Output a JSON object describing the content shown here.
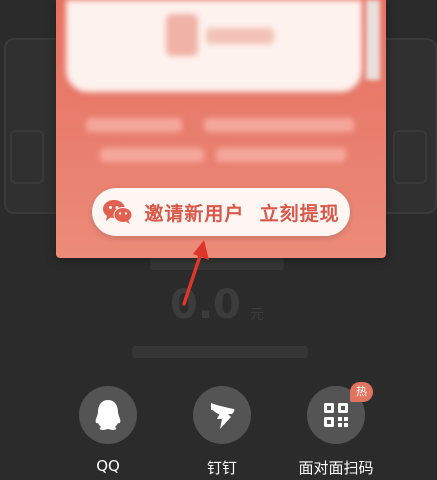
{
  "invite_card": {
    "button_label": "邀请新用户  立刻提现",
    "button_icon": "wechat-icon"
  },
  "balance": {
    "amount": "0.0",
    "unit": "元"
  },
  "share_options": [
    {
      "label": "QQ",
      "icon": "qq-icon"
    },
    {
      "label": "钉钉",
      "icon": "dingtalk-icon"
    },
    {
      "label": "面对面扫码",
      "icon": "qrcode-icon",
      "badge": "热"
    }
  ],
  "colors": {
    "card": "#e87062",
    "button_text": "#d9584a",
    "annotation_arrow": "#e0352b",
    "badge": "#e2735f",
    "overlay": "#2b2b2b"
  }
}
